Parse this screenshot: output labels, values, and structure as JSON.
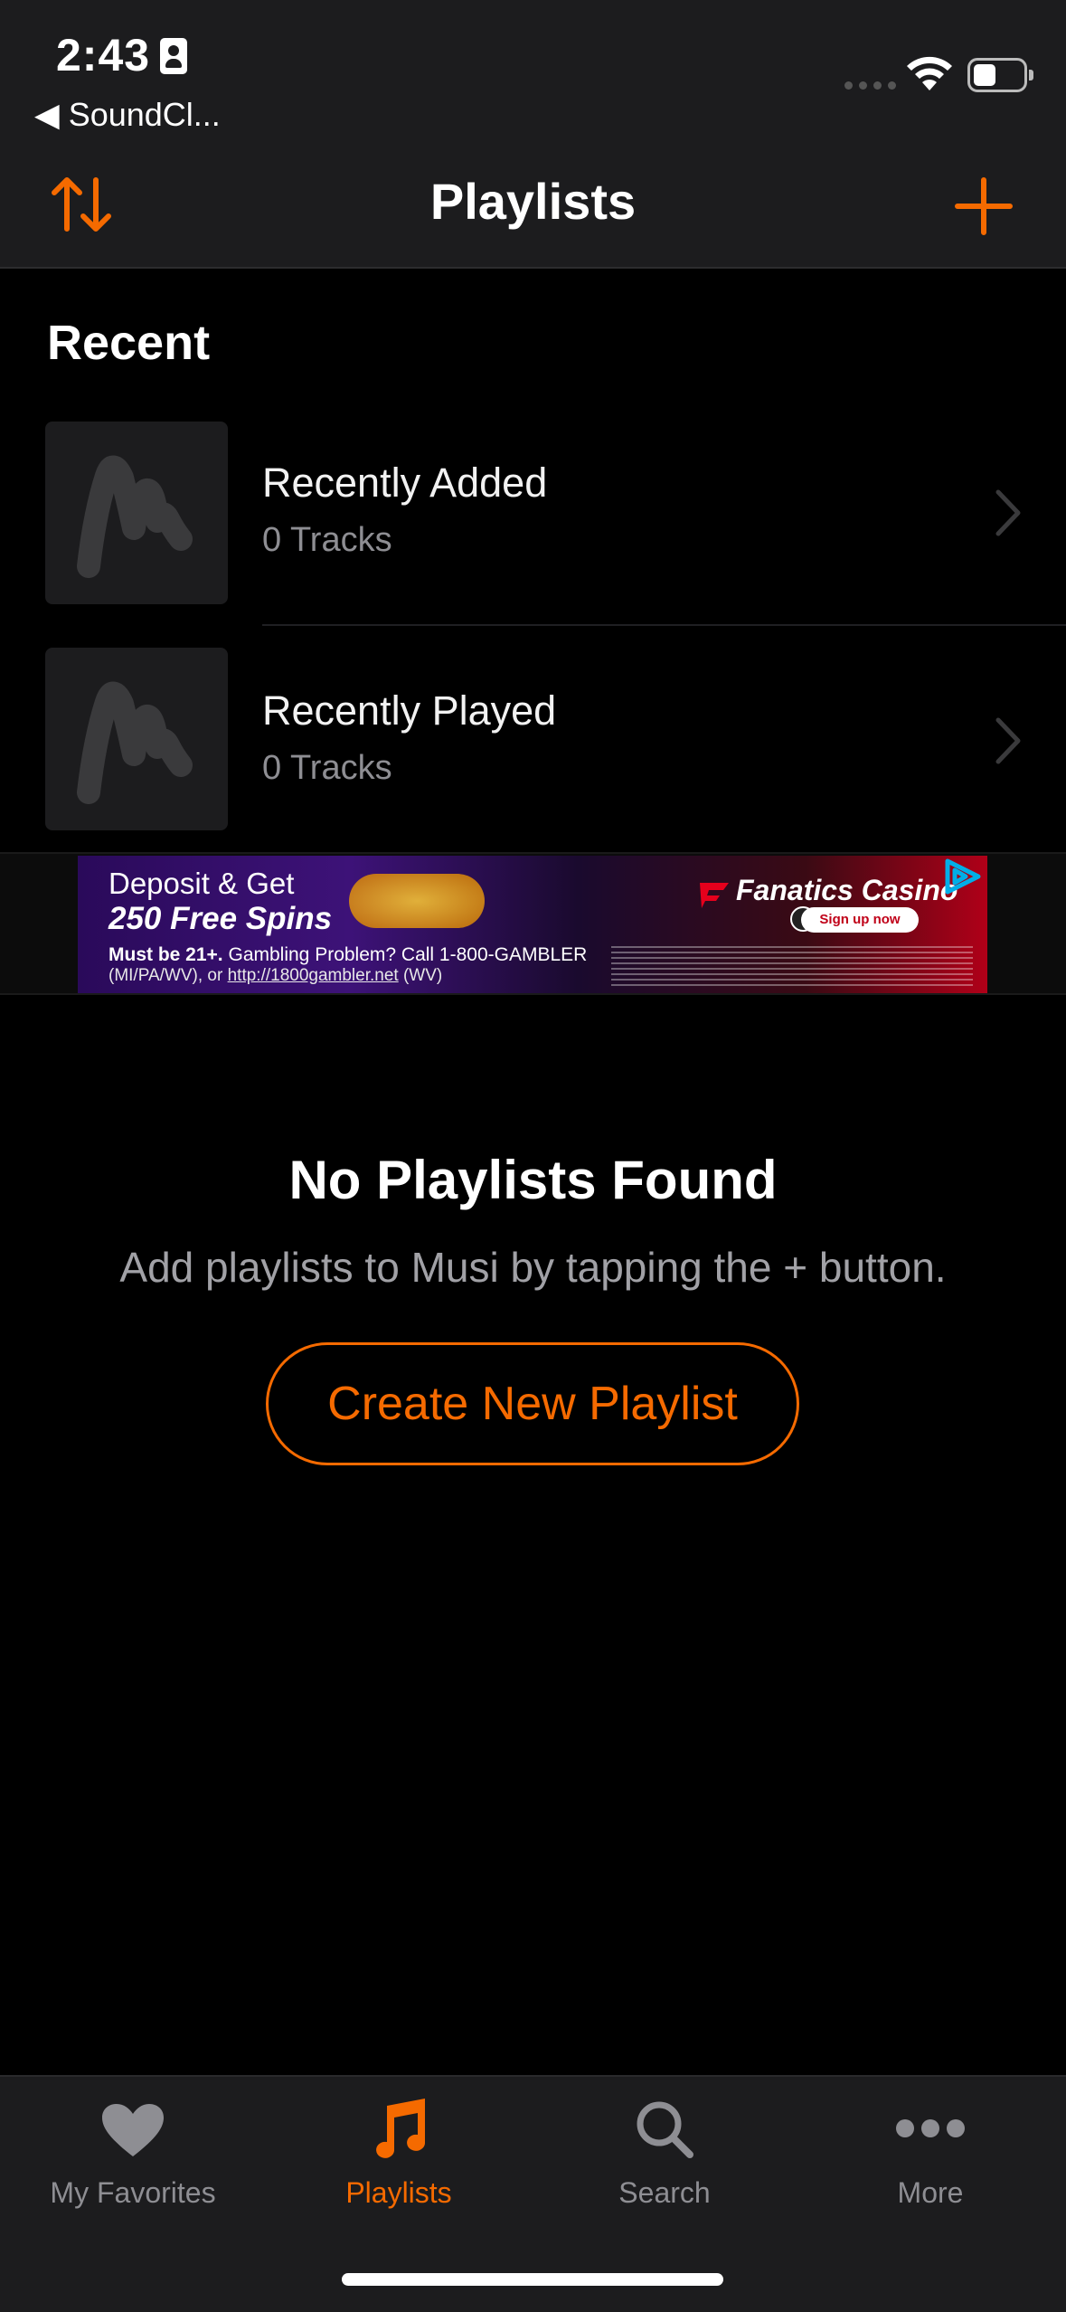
{
  "status_bar": {
    "time": "2:43",
    "back_app": "◀ SoundCl..."
  },
  "nav": {
    "title": "Playlists"
  },
  "recent": {
    "section_title": "Recent",
    "items": [
      {
        "title": "Recently Added",
        "subtitle": "0 Tracks"
      },
      {
        "title": "Recently Played",
        "subtitle": "0 Tracks"
      }
    ]
  },
  "ad": {
    "headline": "Deposit & Get",
    "offer": "250 Free Spins",
    "brand": "Fanatics Casino",
    "cta": "Sign up now",
    "legal_bold": "Must be 21+.",
    "legal_text": "Gambling Problem? Call 1-800-GAMBLER",
    "legal_line2_prefix": "(MI/PA/WV), or ",
    "legal_link": "http://1800gambler.net",
    "legal_line2_suffix": " (WV)"
  },
  "empty_state": {
    "title": "No Playlists Found",
    "subtitle": "Add playlists to Musi by tapping the + button.",
    "button_label": "Create New Playlist"
  },
  "tabs": [
    {
      "label": "My Favorites",
      "icon": "heart-icon",
      "active": false
    },
    {
      "label": "Playlists",
      "icon": "music-note-icon",
      "active": true
    },
    {
      "label": "Search",
      "icon": "search-icon",
      "active": false
    },
    {
      "label": "More",
      "icon": "more-dots-icon",
      "active": false
    }
  ],
  "colors": {
    "accent": "#f56a00",
    "background": "#000000",
    "bar": "#1c1c1e",
    "secondary_text": "#8e8e93"
  }
}
